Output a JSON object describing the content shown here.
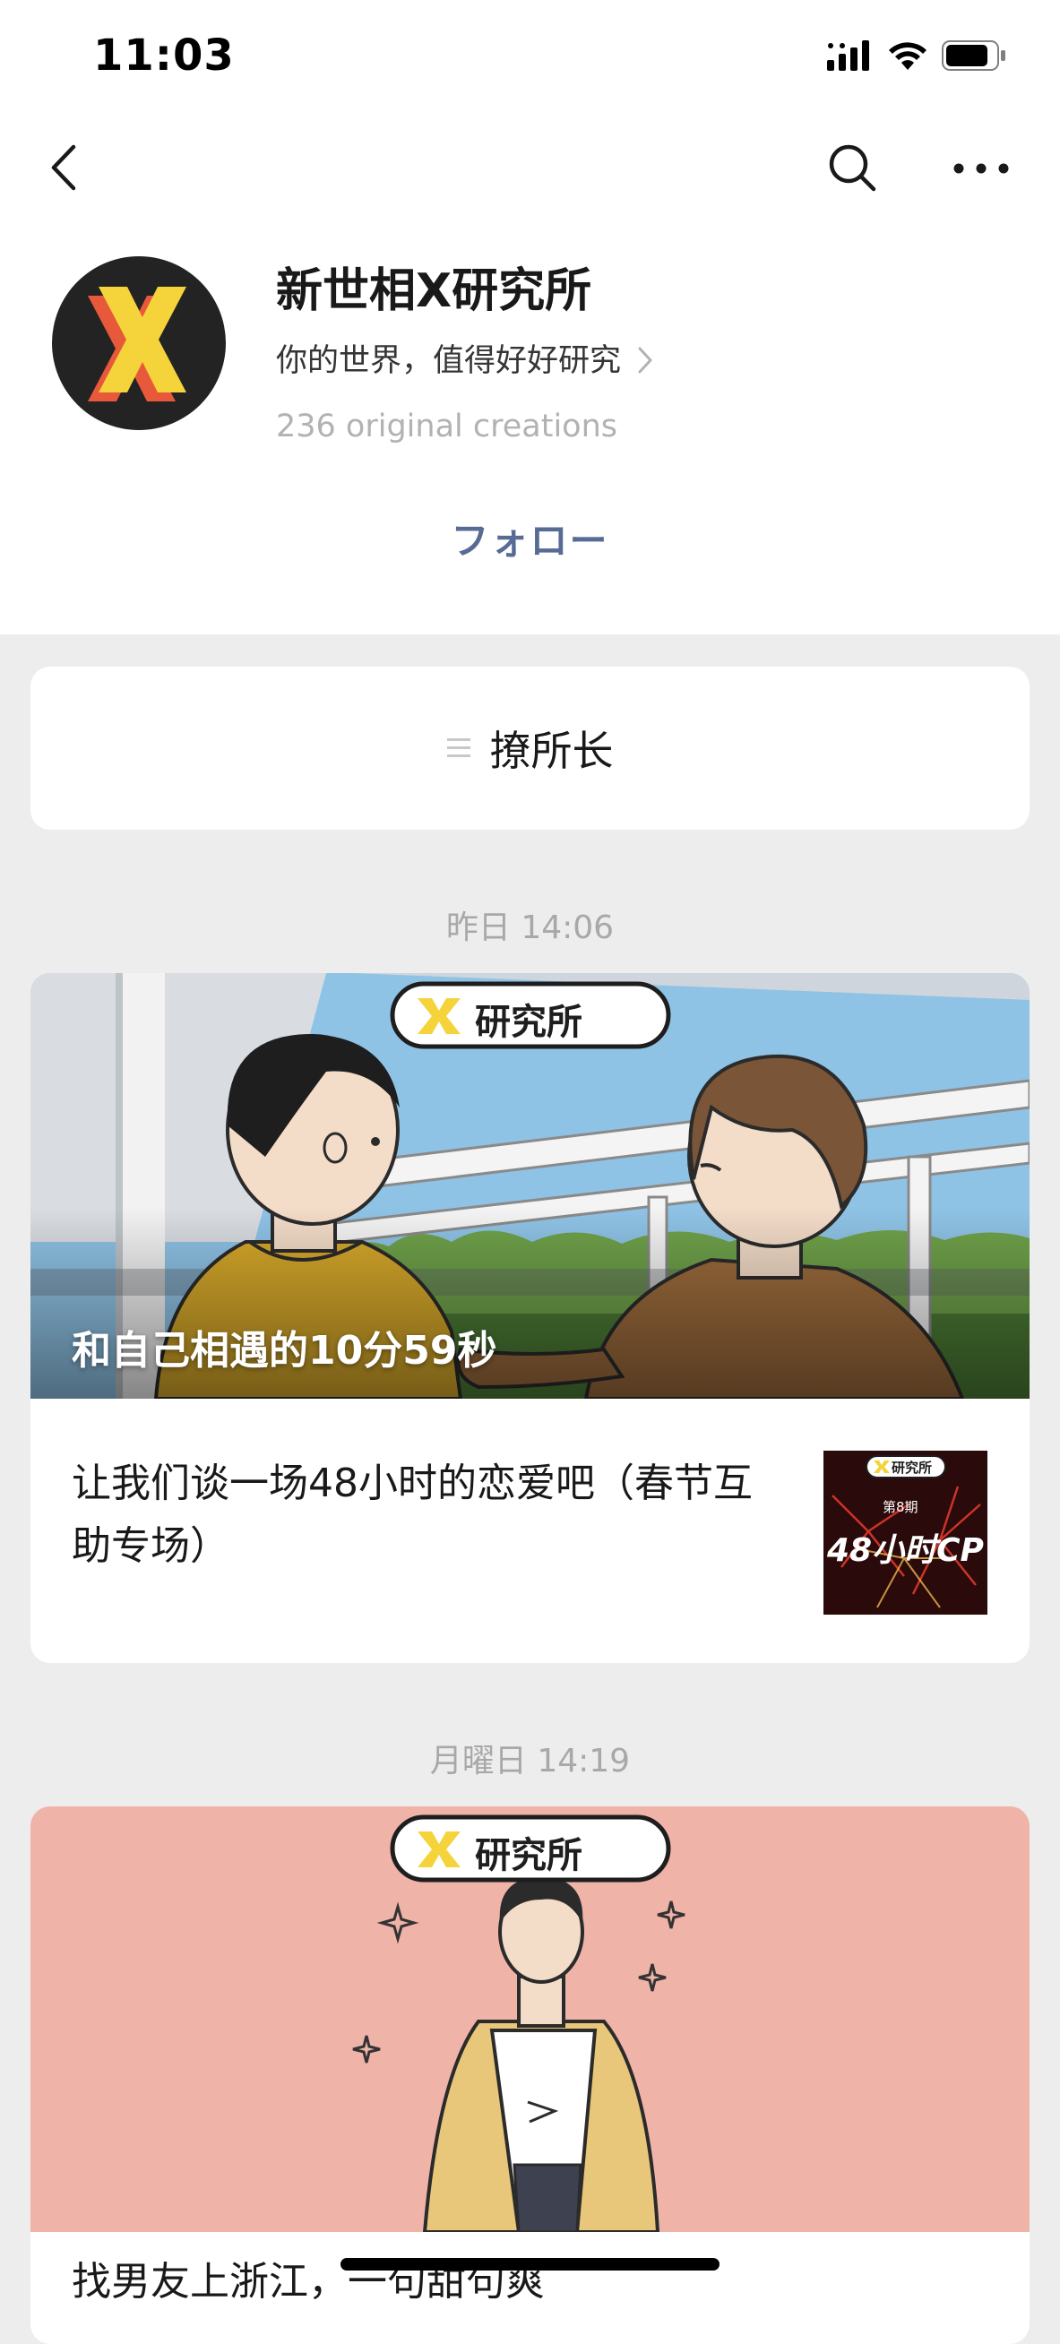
{
  "status_bar": {
    "time": "11:03"
  },
  "account": {
    "name": "新世相X研究所",
    "description": "你的世界，值得好好研究",
    "count": "236 original creations",
    "follow_label": "フォロー",
    "avatar_icon": "x-logo-icon"
  },
  "menu": {
    "label": "撩所长",
    "icon": "menu-lines-icon"
  },
  "posts": [
    {
      "timestamp": "昨日 14:06",
      "badge": "研究所",
      "cover_title": "和自己相遇的10分59秒",
      "item_title": "让我们谈一场48小时的恋爱吧（春节互助专场）",
      "thumb_badge": "研究所",
      "thumb_issue": "第8期",
      "thumb_text": "48小时CP"
    },
    {
      "timestamp": "月曜日 14:19",
      "badge": "研究所",
      "item_title": "找男友上浙江，一句甜句爽"
    }
  ],
  "colors": {
    "accent": "#576b95",
    "background": "#ededed",
    "card": "#ffffff",
    "logo_yellow": "#f5d33a",
    "logo_orange": "#e8583a"
  }
}
